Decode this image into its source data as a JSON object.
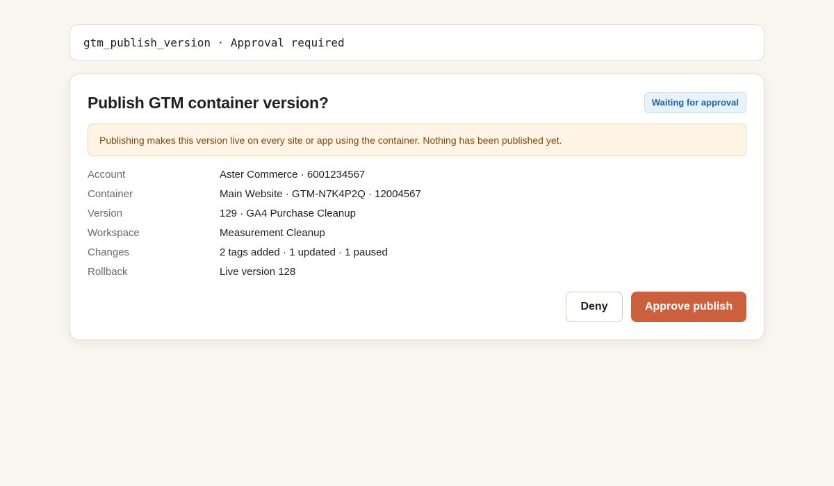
{
  "tool_call": {
    "label": "gtm_publish_version · Approval required"
  },
  "dialog": {
    "title": "Publish GTM container version?",
    "status_badge": "Waiting for approval",
    "notice": "Publishing makes this version live on every site or app using the container. Nothing has been published yet.",
    "details": [
      {
        "label": "Account",
        "value": "Aster Commerce · 6001234567"
      },
      {
        "label": "Container",
        "value": "Main Website · GTM-N7K4P2Q · 12004567"
      },
      {
        "label": "Version",
        "value": "129 · GA4 Purchase Cleanup"
      },
      {
        "label": "Workspace",
        "value": "Measurement Cleanup"
      },
      {
        "label": "Changes",
        "value": "2 tags added · 1 updated · 1 paused"
      },
      {
        "label": "Rollback",
        "value": "Live version 128"
      }
    ],
    "actions": {
      "deny_label": "Deny",
      "approve_label": "Approve publish"
    }
  },
  "colors": {
    "background": "#f9f6f0",
    "badge_text": "#1e63a8",
    "notice_background": "#fff4e5",
    "notice_text": "#7a4a0e",
    "approve_button": "#cc5f3c"
  }
}
